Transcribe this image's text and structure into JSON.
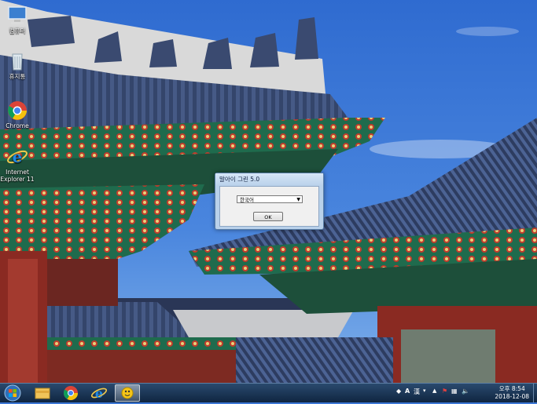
{
  "desktop": {
    "icons": [
      {
        "label": "컴퓨터",
        "icon": "computer-icon"
      },
      {
        "label": "휴지통",
        "icon": "recycle-bin-icon"
      },
      {
        "label": "Chrome",
        "icon": "chrome-icon"
      },
      {
        "label": "Internet Explorer 11",
        "icon": "ie-icon"
      }
    ]
  },
  "dialog": {
    "title": "말아이 그린 5.0",
    "language_select": "한국어",
    "ok_label": "OK"
  },
  "taskbar": {
    "pinned": [
      "start-orb-icon",
      "explorer-icon",
      "chrome-icon",
      "ie-icon",
      "app-icon"
    ],
    "tray": {
      "ime_a": "A",
      "ime_han": "漢",
      "clock_time": "오후 8:54",
      "clock_date": "2018-12-08"
    }
  },
  "colors": {
    "sky": "#3d78d6",
    "roof_tile": "#34456b",
    "roof_beam_green": "#1f6b4d",
    "roof_red": "#a8322a",
    "dialog_frame": "#b9d1ea",
    "taskbar": "#1a3556"
  }
}
